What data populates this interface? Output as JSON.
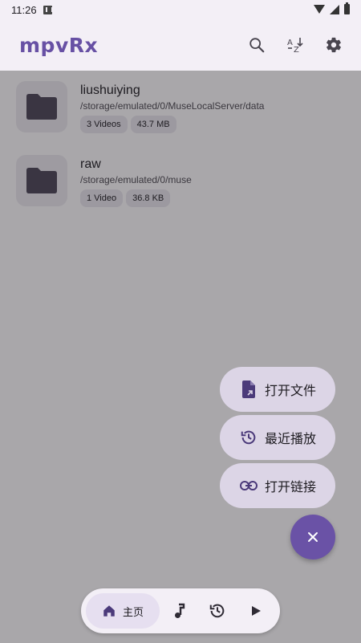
{
  "status_bar": {
    "time": "11:26"
  },
  "app_bar": {
    "title": "mpvRx",
    "actions": [
      "search-icon",
      "sort-az-icon",
      "settings-icon"
    ]
  },
  "folders": [
    {
      "name": "liushuiying",
      "path": "/storage/emulated/0/MuseLocalServer/data",
      "count": "3 Videos",
      "size": "43.7 MB"
    },
    {
      "name": "raw",
      "path": "/storage/emulated/0/muse",
      "count": "1 Video",
      "size": "36.8 KB"
    }
  ],
  "fab_menu": [
    {
      "label": "打开文件",
      "icon": "open-file-icon"
    },
    {
      "label": "最近播放",
      "icon": "history-icon"
    },
    {
      "label": "打开链接",
      "icon": "link-icon"
    }
  ],
  "fab": {
    "icon": "close-icon"
  },
  "bottom_nav": {
    "home_label": "主页",
    "items": [
      "home-icon",
      "music-note-icon",
      "history-icon",
      "play-icon"
    ]
  },
  "colors": {
    "accent": "#6750a4",
    "fab": "#6a52a6",
    "menu_item_bg": "#dcd5e6",
    "scrim_bg": "#a9a7aa"
  }
}
